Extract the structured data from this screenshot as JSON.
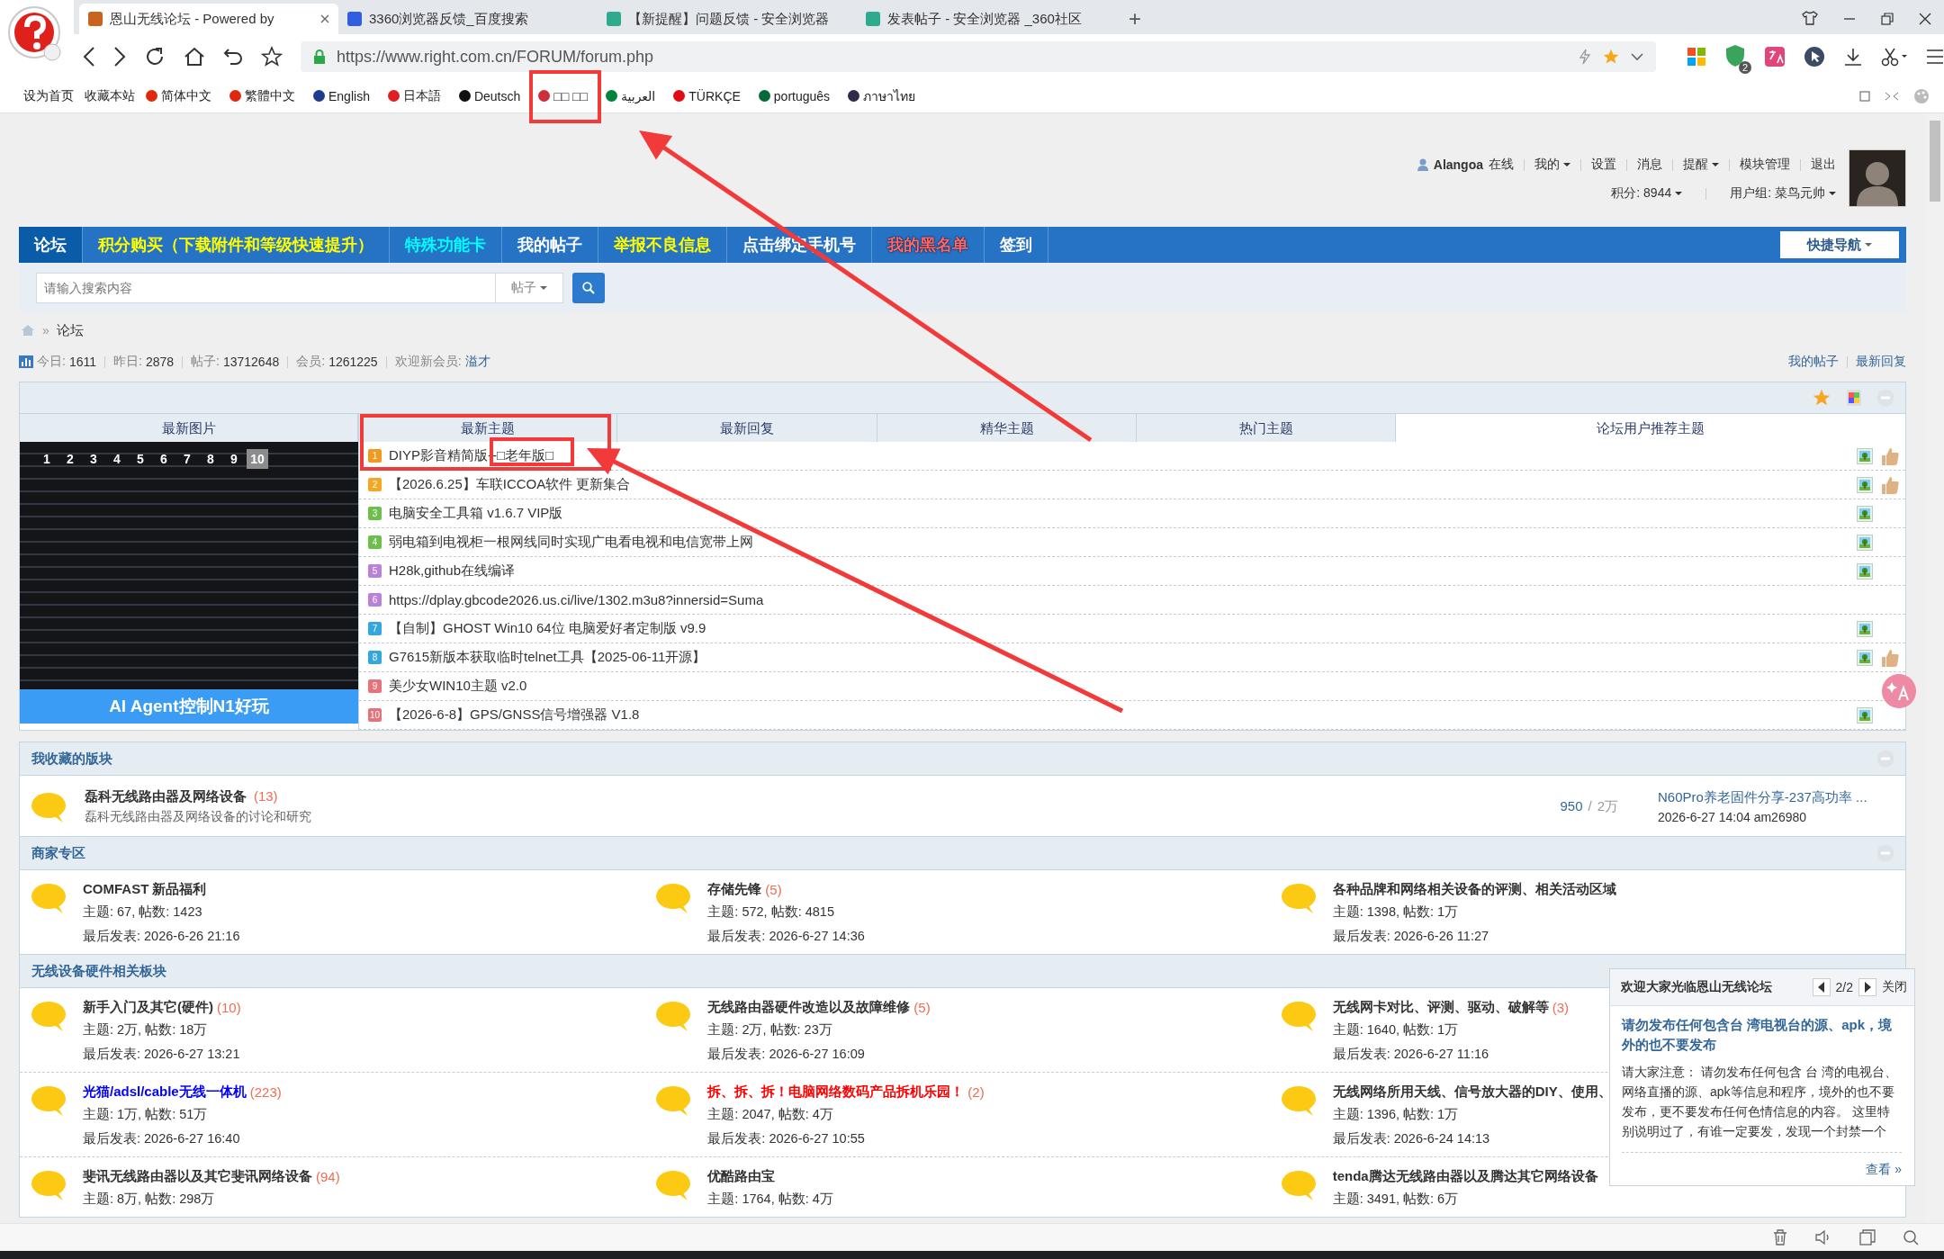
{
  "browser": {
    "tabs": [
      {
        "title": "恩山无线论坛 - Powered by",
        "selected": true,
        "color": "#c8641e"
      },
      {
        "title": "3360浏览器反馈_百度搜索",
        "selected": false,
        "color": "#2f5fe0"
      },
      {
        "title": "【新提醒】问题反馈 - 安全浏览器",
        "selected": false,
        "color": "#2eaa8c"
      },
      {
        "title": "发表帖子 - 安全浏览器 _360社区",
        "selected": false,
        "color": "#2eaa8c"
      }
    ],
    "new_tab": "+",
    "url": "https://www.right.com.cn/FORUM/forum.php",
    "extension_badge": "2"
  },
  "bookmarks": {
    "links": [
      "设为首页",
      "收藏本站"
    ],
    "languages": [
      {
        "label": "简体中文",
        "color": "#de2910"
      },
      {
        "label": "繁體中文",
        "color": "#de2910"
      },
      {
        "label": "English",
        "color": "#1f3c8c"
      },
      {
        "label": "日本語",
        "color": "#e02020"
      },
      {
        "label": "Deutsch",
        "color": "#111111"
      },
      {
        "label": "□□ □□",
        "color": "#cd2e3a"
      },
      {
        "label": "العربية",
        "color": "#00843d"
      },
      {
        "label": "TÜRKÇE",
        "color": "#e30a17"
      },
      {
        "label": "português",
        "color": "#046a38"
      },
      {
        "label": "ภาษาไทย",
        "color": "#2d2a4a"
      }
    ]
  },
  "user": {
    "name": "Alangoa",
    "status": "在线",
    "menu": [
      {
        "label": "我的",
        "dropdown": true
      },
      {
        "label": "设置",
        "dropdown": false
      },
      {
        "label": "消息",
        "dropdown": false
      },
      {
        "label": "提醒",
        "dropdown": true
      },
      {
        "label": "模块管理",
        "dropdown": false
      },
      {
        "label": "退出",
        "dropdown": false
      }
    ],
    "stats": [
      {
        "label": "积分: 8944",
        "dropdown": true
      },
      {
        "label": "用户组: 菜鸟元帅",
        "dropdown": true
      }
    ]
  },
  "nav": {
    "items": [
      {
        "label": "论坛",
        "selected": true,
        "kind": "plain"
      },
      {
        "label": "积分购买（下载附件和等级快速提升）",
        "selected": false,
        "kind": "promo"
      },
      {
        "label": "特殊功能卡",
        "selected": false,
        "kind": "feature"
      },
      {
        "label": "我的帖子",
        "selected": false,
        "kind": "plain"
      },
      {
        "label": "举报不良信息",
        "selected": false,
        "kind": "promo"
      },
      {
        "label": "点击绑定手机号",
        "selected": false,
        "kind": "plain"
      },
      {
        "label": "我的黑名单",
        "selected": false,
        "kind": "alert"
      },
      {
        "label": "签到",
        "selected": false,
        "kind": "plain"
      }
    ],
    "quick_nav": "快捷导航"
  },
  "search": {
    "placeholder": "请输入搜索内容",
    "scope": "帖子"
  },
  "breadcrumb": {
    "separator": "»",
    "current": "论坛"
  },
  "stats": {
    "items": [
      {
        "label": "今日:",
        "value": "1611"
      },
      {
        "label": "昨日:",
        "value": "2878"
      },
      {
        "label": "帖子:",
        "value": "13712648"
      },
      {
        "label": "会员:",
        "value": "1261225"
      }
    ],
    "welcome": "欢迎新会员:",
    "new_member": "溢才",
    "links": [
      "我的帖子",
      "最新回复"
    ]
  },
  "portal": {
    "image_tab": "最新图片",
    "slides": [
      {
        "label": "1",
        "selected": false
      },
      {
        "label": "2",
        "selected": false
      },
      {
        "label": "3",
        "selected": false
      },
      {
        "label": "4",
        "selected": false
      },
      {
        "label": "5",
        "selected": false
      },
      {
        "label": "6",
        "selected": false
      },
      {
        "label": "7",
        "selected": false
      },
      {
        "label": "8",
        "selected": false
      },
      {
        "label": "9",
        "selected": false
      },
      {
        "label": "10",
        "selected": true
      }
    ],
    "caption": "AI Agent控制N1好玩",
    "tabs": [
      {
        "label": "最新主题",
        "selected": false
      },
      {
        "label": "最新回复",
        "selected": false
      },
      {
        "label": "精华主题",
        "selected": false
      },
      {
        "label": "热门主题",
        "selected": false
      },
      {
        "label": "论坛用户推荐主题",
        "selected": true
      }
    ],
    "threads": [
      {
        "rank": "1",
        "color": "#f39a1e",
        "title": "DIYP影音精简版--□老年版□",
        "image": true,
        "liked": true
      },
      {
        "rank": "2",
        "color": "#f5a623",
        "title": "【2026.6.25】车联ICCOA软件 更新集合",
        "image": true,
        "liked": true
      },
      {
        "rank": "3",
        "color": "#6cc04a",
        "title": "电脑安全工具箱 v1.6.7 VIP版",
        "image": true,
        "liked": false
      },
      {
        "rank": "4",
        "color": "#6cc04a",
        "title": "弱电箱到电视柜一根网线同时实现广电看电视和电信宽带上网",
        "image": true,
        "liked": false
      },
      {
        "rank": "5",
        "color": "#b882d8",
        "title": "H28k,github在线编译",
        "image": true,
        "liked": false
      },
      {
        "rank": "6",
        "color": "#b882d8",
        "title": "https://dplay.gbcode2026.us.ci/live/1302.m3u8?innersid=Suma",
        "image": false,
        "liked": false
      },
      {
        "rank": "7",
        "color": "#35a7e0",
        "title": "【自制】GHOST Win10 64位 电脑爱好者定制版 v9.9",
        "image": true,
        "liked": false
      },
      {
        "rank": "8",
        "color": "#35a7e0",
        "title": "G7615新版本获取临时telnet工具【2025-06-11开源】",
        "image": true,
        "liked": true
      },
      {
        "rank": "9",
        "color": "#e8727a",
        "title": "美少女WIN10主题 v2.0",
        "image": false,
        "liked": false
      },
      {
        "rank": "10",
        "color": "#e8727a",
        "title": "【2026-6-8】GPS/GNSS信号增强器 V1.8",
        "image": true,
        "liked": false
      }
    ]
  },
  "favorites": {
    "title": "我收藏的版块",
    "forum": {
      "name": "磊科无线路由器及网络设备",
      "count": "(13)",
      "description": "磊科无线路由器及网络设备的讨论和研究",
      "threads": "950",
      "posts": "2万",
      "separator": "/",
      "last_title": "N60Pro养老固件分享-237高功率 ...",
      "last_meta": "2026-6-27 14:04 am26980"
    }
  },
  "sections": [
    {
      "title": "商家专区",
      "collapsible": true,
      "rows": [
        [
          {
            "name": "COMFAST 新品福利",
            "color": "#333333",
            "stats": "主题: 67, 帖数: 1423",
            "last": "最后发表: 2026-6-26 21:16"
          },
          {
            "name": "存储先锋",
            "count": "(5)",
            "color": "#333333",
            "stats": "主题: 572, 帖数: 4815",
            "last": "最后发表: 2026-6-27 14:36"
          },
          {
            "name": "各种品牌和网络相关设备的评测、相关活动区域",
            "color": "#333333",
            "stats": "主题: 1398, 帖数: 1万",
            "last": "最后发表: 2026-6-26 11:27"
          }
        ]
      ]
    },
    {
      "title": "无线设备硬件相关板块",
      "collapsible": false,
      "rows": [
        [
          {
            "name": "新手入门及其它(硬件)",
            "count": "(10)",
            "color": "#333333",
            "stats": "主题: 2万, 帖数: 18万",
            "last": "最后发表: 2026-6-27 13:21"
          },
          {
            "name": "无线路由器硬件改造以及故障维修",
            "count": "(5)",
            "color": "#333333",
            "stats": "主题: 2万, 帖数: 23万",
            "last": "最后发表: 2026-6-27 16:09"
          },
          {
            "name": "无线网卡对比、评测、驱动、破解等",
            "count": "(3)",
            "color": "#333333",
            "stats": "主题: 1640, 帖数: 1万",
            "last": "最后发表: 2026-6-27 11:16"
          }
        ],
        [
          {
            "name": "光猫/adsl/cable无线一体机",
            "count": "(223)",
            "color": "#0000ff",
            "stats": "主题: 1万, 帖数: 51万",
            "last": "最后发表: 2026-6-27 16:40"
          },
          {
            "name": "拆、拆、拆！电脑网络数码产品拆机乐园！",
            "count": "(2)",
            "color": "#ff0000",
            "stats": "主题: 2047, 帖数: 4万",
            "last": "最后发表: 2026-6-27 10:55"
          },
          {
            "name": "无线网络所用天线、信号放大器的DIY、使用、",
            "color": "#333333",
            "stats": "主题: 1396, 帖数: 1万",
            "last": "最后发表: 2026-6-24 14:13"
          }
        ],
        [
          {
            "name": "斐讯无线路由器以及其它斐讯网络设备",
            "count": "(94)",
            "color": "#333333",
            "stats": "主题: 8万, 帖数: 298万"
          },
          {
            "name": "优酷路由宝",
            "color": "#333333",
            "stats": "主题: 1764, 帖数: 4万"
          },
          {
            "name": "tenda腾达无线路由器以及腾达其它网络设备",
            "color": "#333333",
            "stats": "主题: 3491, 帖数: 6万"
          }
        ]
      ]
    }
  ],
  "notice": {
    "title": "欢迎大家光临恩山无线论坛",
    "page": "2/2",
    "close": "关闭",
    "heading": "请勿发布任何包含台 湾电视台的源、apk，境外的也不要发布",
    "body": "请大家注意： 请勿发布任何包含 台 湾的电视台、网络直播的源、apk等信息和程序，境外的也不要发布，更不要发布任何色情信息的内容。 这里特别说明过了，有谁一定要发，发现一个封禁一个",
    "more": "查看 »"
  },
  "annotations": [
    {
      "kind": "box"
    },
    {
      "kind": "box"
    },
    {
      "kind": "box"
    },
    {
      "kind": "arrow"
    },
    {
      "kind": "arrow"
    }
  ]
}
